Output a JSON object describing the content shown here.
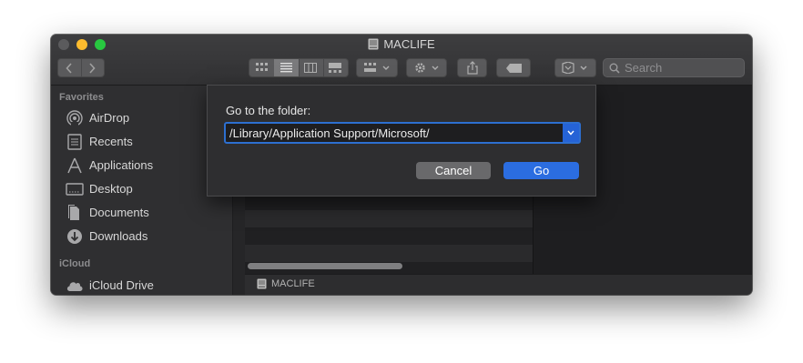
{
  "window": {
    "title": "MACLIFE",
    "traffic_lights": [
      "close",
      "minimize",
      "zoom"
    ]
  },
  "toolbar": {
    "nav": [
      "back-icon",
      "forward-icon"
    ],
    "view_modes": [
      "icon-view-icon",
      "list-view-icon",
      "column-view-icon",
      "gallery-view-icon"
    ],
    "active_view": "list",
    "search_placeholder": "Search"
  },
  "sidebar": {
    "sections": [
      {
        "heading": "Favorites",
        "items": [
          {
            "label": "AirDrop",
            "icon": "airdrop-icon"
          },
          {
            "label": "Recents",
            "icon": "recents-icon"
          },
          {
            "label": "Applications",
            "icon": "applications-icon"
          },
          {
            "label": "Desktop",
            "icon": "desktop-icon"
          },
          {
            "label": "Documents",
            "icon": "documents-icon"
          },
          {
            "label": "Downloads",
            "icon": "downloads-icon"
          }
        ]
      },
      {
        "heading": "iCloud",
        "items": [
          {
            "label": "iCloud Drive",
            "icon": "cloud-icon"
          }
        ]
      }
    ]
  },
  "pathbar": {
    "label": "MACLIFE"
  },
  "dialog": {
    "prompt": "Go to the folder:",
    "field_value": "/Library/Application Support/Microsoft/",
    "cancel_label": "Cancel",
    "go_label": "Go"
  },
  "colors": {
    "accent": "#2b6de0",
    "window_bg": "#2a2a2c"
  }
}
